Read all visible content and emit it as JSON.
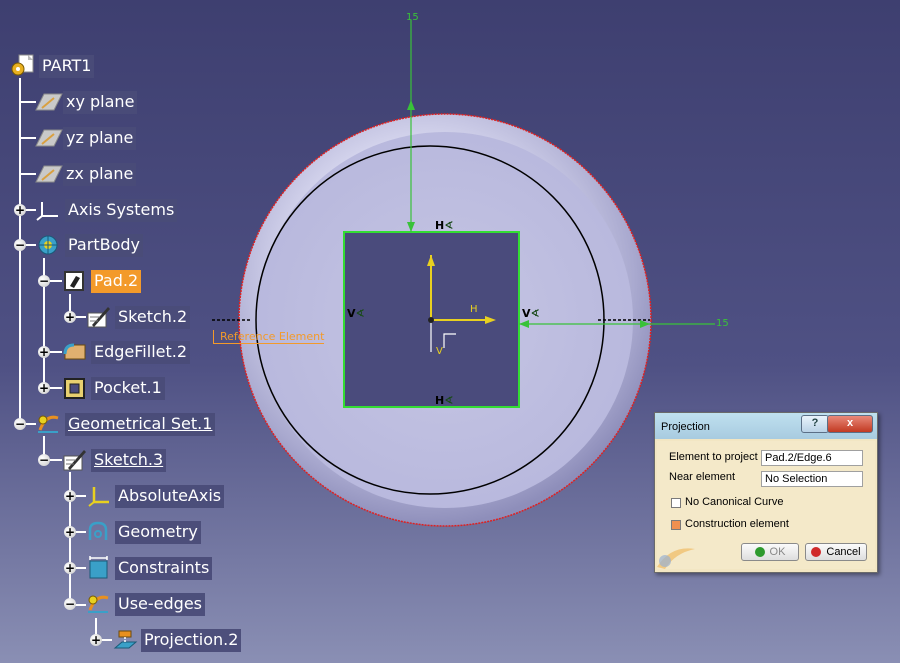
{
  "tree": {
    "items": [
      {
        "label": "PART1",
        "icon": "part-icon"
      },
      {
        "label": "xy plane",
        "icon": "plane-icon"
      },
      {
        "label": "yz plane",
        "icon": "plane-icon"
      },
      {
        "label": "zx plane",
        "icon": "plane-icon"
      },
      {
        "label": "Axis Systems",
        "icon": "axis-system-icon"
      },
      {
        "label": "PartBody",
        "icon": "body-icon"
      },
      {
        "label": "Pad.2",
        "icon": "pad-icon"
      },
      {
        "label": "Sketch.2",
        "icon": "sketch-icon"
      },
      {
        "label": "EdgeFillet.2",
        "icon": "fillet-icon"
      },
      {
        "label": "Pocket.1",
        "icon": "pocket-icon"
      },
      {
        "label": "Geometrical Set.1",
        "icon": "geometrical-set-icon"
      },
      {
        "label": "Sketch.3",
        "icon": "sketch-icon"
      },
      {
        "label": "AbsoluteAxis",
        "icon": "absolute-axis-icon"
      },
      {
        "label": "Geometry",
        "icon": "geometry-icon"
      },
      {
        "label": "Constraints",
        "icon": "constraints-icon"
      },
      {
        "label": "Use-edges",
        "icon": "use-edges-icon"
      },
      {
        "label": "Projection.2",
        "icon": "projection-icon"
      }
    ]
  },
  "viewport": {
    "dim_top": "15",
    "dim_right": "15",
    "reference_label": "Reference Element",
    "constraint_top": "H",
    "constraint_bottom": "H",
    "constraint_left": "V",
    "constraint_right": "V",
    "axis_h": "H",
    "axis_v": "V"
  },
  "dialog": {
    "title": "Projection",
    "help_label": "?",
    "close_label": "x",
    "element_label": "Element to project",
    "element_value": "Pad.2/Edge.6",
    "near_label": "Near element",
    "near_value": "No Selection",
    "no_canonical_label": "No Canonical Curve",
    "no_canonical_checked": false,
    "construction_label": "Construction element",
    "construction_checked": true,
    "ok_label": "OK",
    "cancel_label": "Cancel"
  },
  "colors": {
    "background_top": "#3e3f70",
    "background_bottom": "#8a8fb4",
    "selection": "#f39a2a",
    "dimension": "#39c239",
    "profile_green": "#33dd33",
    "edge_red": "#e02020"
  }
}
